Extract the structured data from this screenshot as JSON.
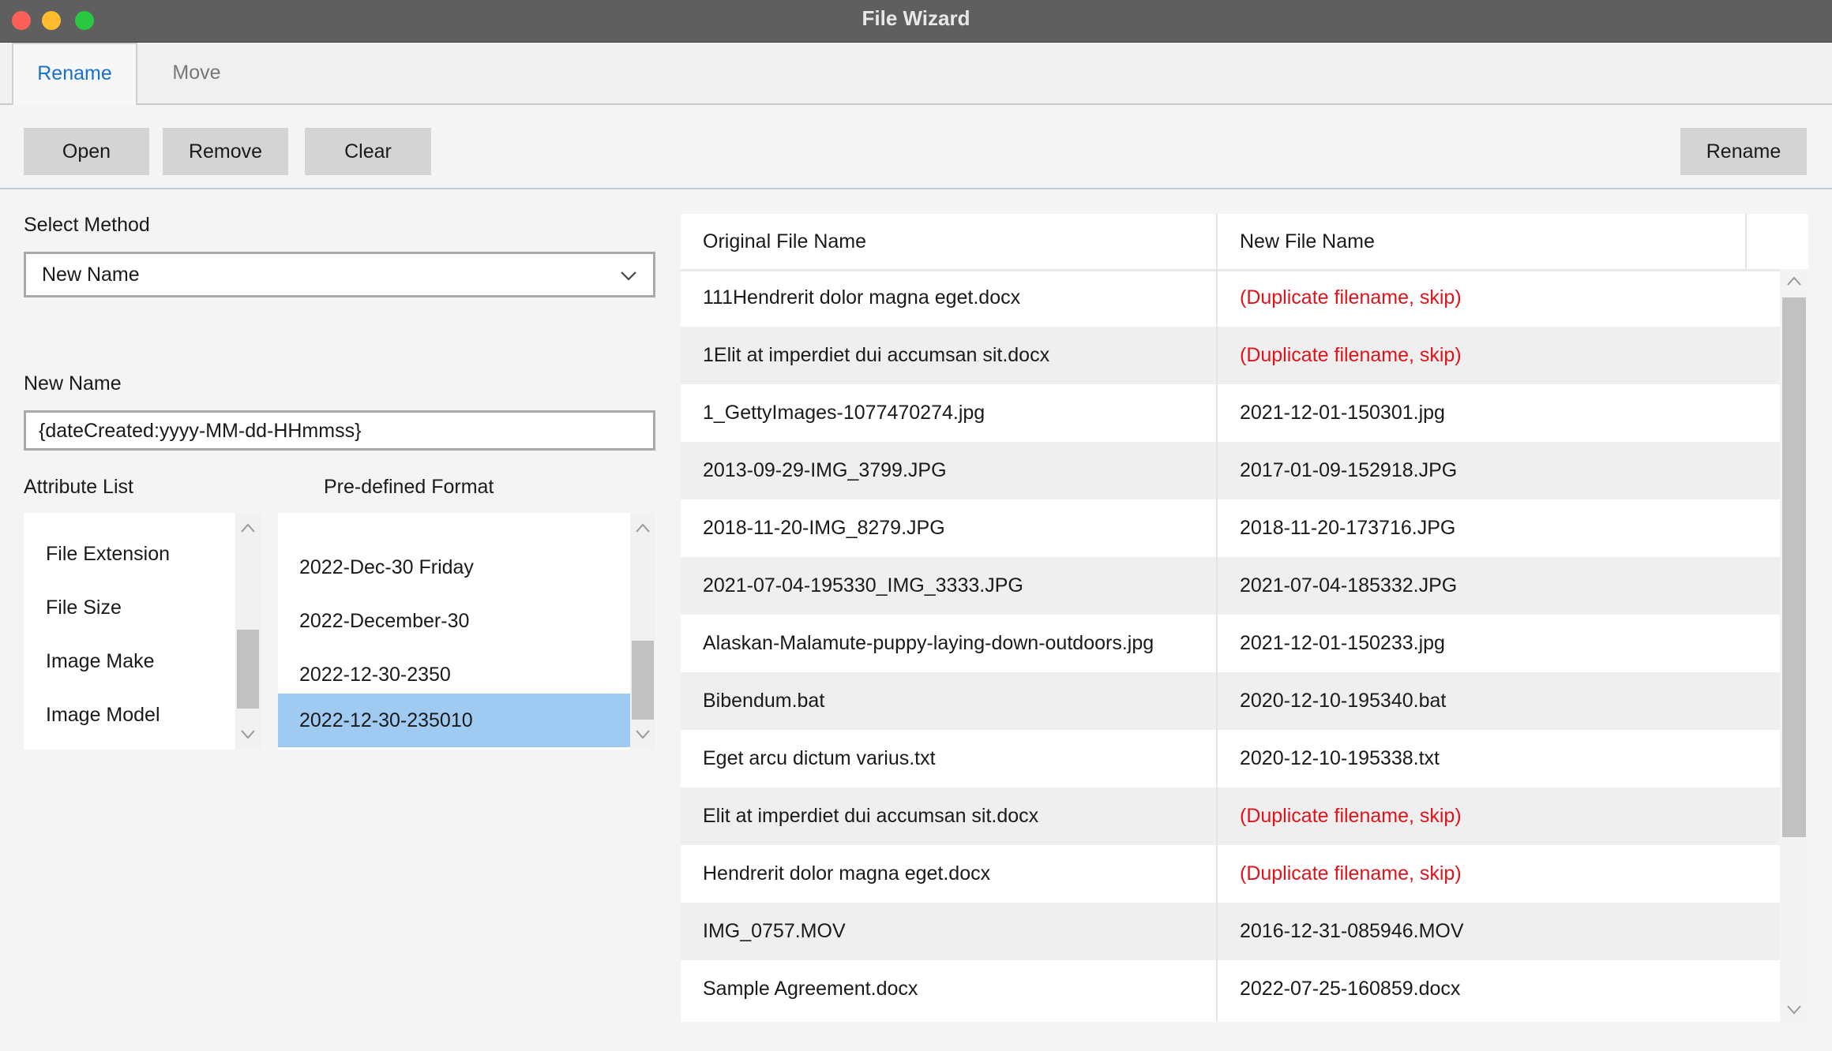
{
  "window": {
    "title": "File Wizard"
  },
  "tabs": {
    "rename": "Rename",
    "move": "Move"
  },
  "toolbar": {
    "open": "Open",
    "remove": "Remove",
    "clear": "Clear",
    "rename": "Rename"
  },
  "method": {
    "label": "Select Method",
    "selected": "New Name"
  },
  "new_name": {
    "label": "New Name",
    "value": "{dateCreated:yyyy-MM-dd-HHmmss}"
  },
  "attributes": {
    "label": "Attribute List",
    "items": [
      "File Extension",
      "File Size",
      "Image Make",
      "Image Model"
    ]
  },
  "formats": {
    "label": "Pre-defined Format",
    "items": [
      "2022-Dec-30 Friday",
      "2022-December-30",
      "2022-12-30-2350",
      "2022-12-30-235010"
    ],
    "selected_index": 3
  },
  "table": {
    "columns": [
      "Original File Name",
      "New File Name"
    ],
    "rows": [
      {
        "original": "111Hendrerit dolor magna eget.docx",
        "new": "(Duplicate filename, skip)",
        "duplicate": true
      },
      {
        "original": "1Elit at imperdiet dui accumsan sit.docx",
        "new": "(Duplicate filename, skip)",
        "duplicate": true
      },
      {
        "original": "1_GettyImages-1077470274.jpg",
        "new": "2021-12-01-150301.jpg",
        "duplicate": false
      },
      {
        "original": "2013-09-29-IMG_3799.JPG",
        "new": "2017-01-09-152918.JPG",
        "duplicate": false
      },
      {
        "original": "2018-11-20-IMG_8279.JPG",
        "new": "2018-11-20-173716.JPG",
        "duplicate": false
      },
      {
        "original": "2021-07-04-195330_IMG_3333.JPG",
        "new": "2021-07-04-185332.JPG",
        "duplicate": false
      },
      {
        "original": "Alaskan-Malamute-puppy-laying-down-outdoors.jpg",
        "new": "2021-12-01-150233.jpg",
        "duplicate": false
      },
      {
        "original": "Bibendum.bat",
        "new": "2020-12-10-195340.bat",
        "duplicate": false
      },
      {
        "original": "Eget arcu dictum varius.txt",
        "new": "2020-12-10-195338.txt",
        "duplicate": false
      },
      {
        "original": "Elit at imperdiet dui accumsan sit.docx",
        "new": "(Duplicate filename, skip)",
        "duplicate": true
      },
      {
        "original": "Hendrerit dolor magna eget.docx",
        "new": "(Duplicate filename, skip)",
        "duplicate": true
      },
      {
        "original": "IMG_0757.MOV",
        "new": "2016-12-31-085946.MOV",
        "duplicate": false
      },
      {
        "original": "Sample Agreement.docx",
        "new": "2022-07-25-160859.docx",
        "duplicate": false
      }
    ]
  },
  "colors": {
    "accent": "#1570d0",
    "selection": "#9fcbf2",
    "duplicate": "#e0121a"
  },
  "icons": {
    "dropdown": "chevron-down-icon",
    "scroll_up": "chevron-up-icon",
    "scroll_down": "chevron-down-icon"
  }
}
